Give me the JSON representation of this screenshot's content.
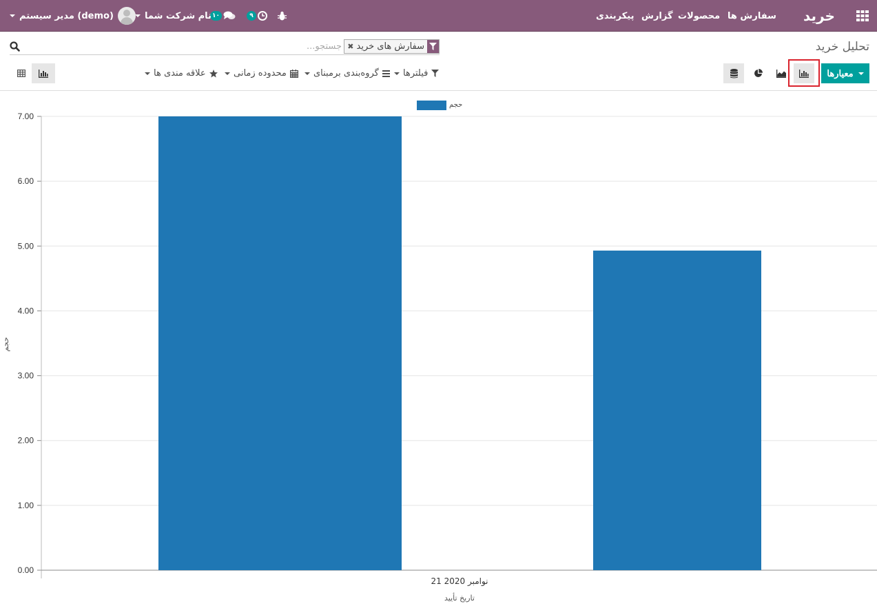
{
  "navbar": {
    "app_name": "خرید",
    "menu": [
      "سفارش ها",
      "محصولات",
      "گزارش",
      "پیکربندی"
    ],
    "activity_count": "۹",
    "message_count": "۱۰",
    "company": "نام شرکت شما",
    "user": "مدیر سیستم (demo)"
  },
  "control_panel": {
    "title": "تحلیل خرید",
    "facet_value": "سفارش های خرید",
    "search_placeholder": "جستجو...",
    "measures_label": "معیارها",
    "filters_label": "فیلترها",
    "groupby_label": "گروه‌بندی برمبنای",
    "timerange_label": "محدوده زمانی",
    "favorites_label": "علاقه مندی ها"
  },
  "chart_data": {
    "type": "bar",
    "categories": [
      "21 نوامبر 2020",
      ""
    ],
    "series": [
      {
        "name": "حجم",
        "values": [
          7.0,
          4.93
        ]
      }
    ],
    "xlabel": "تاریخ تأیید",
    "ylabel": "حجم",
    "ylim": [
      0,
      7
    ],
    "yticks": [
      "0.00",
      "1.00",
      "2.00",
      "3.00",
      "4.00",
      "5.00",
      "6.00",
      "7.00"
    ],
    "legend": "top-center",
    "grid": true,
    "bar_color": "#1F77B4"
  },
  "colors": {
    "brand": "#875A7B",
    "primary": "#00A09D",
    "highlight": "#d9232d"
  }
}
